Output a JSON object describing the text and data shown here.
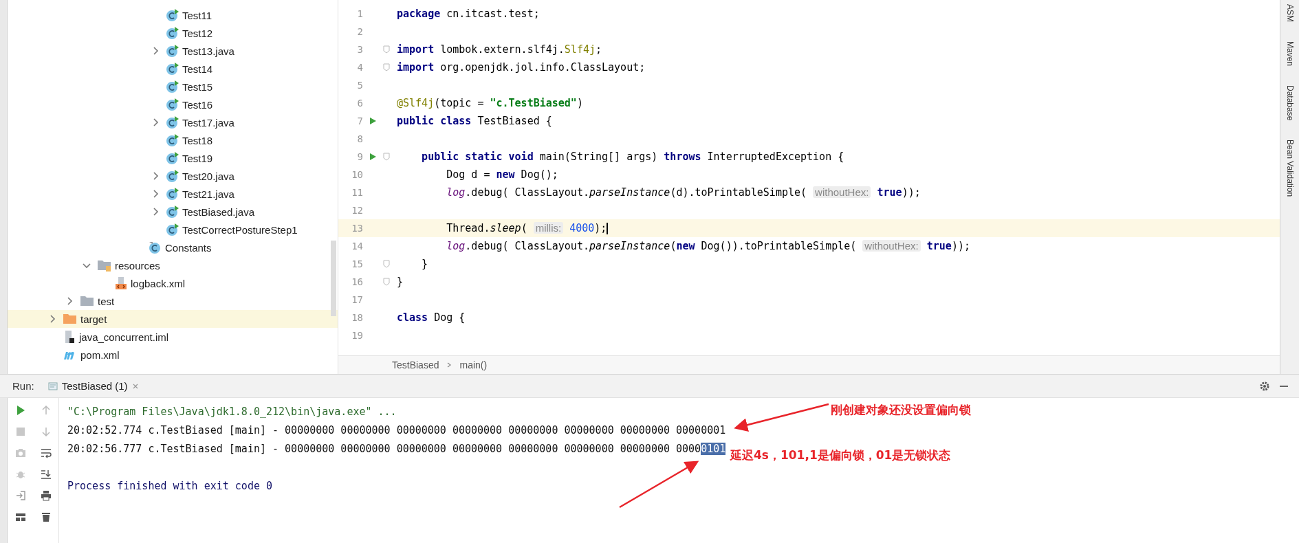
{
  "project_tree": [
    {
      "children": [
        {
          "children": [
            {
              "children": [
                {
                  "children": [
                    {
                      "children": [
                        {
                          "children": [
                            {
                              "label": "Test11",
                              "kind": "runnable-class",
                              "highlighted": false
                            },
                            {
                              "label": "Test12",
                              "kind": "runnable-class",
                              "highlighted": false
                            },
                            {
                              "label": "Test13.java",
                              "kind": "runnable-class",
                              "expanded": false,
                              "highlighted": false
                            },
                            {
                              "label": "Test14",
                              "kind": "runnable-class",
                              "highlighted": false
                            },
                            {
                              "label": "Test15",
                              "kind": "runnable-class",
                              "highlighted": false
                            },
                            {
                              "label": "Test16",
                              "kind": "runnable-class",
                              "highlighted": false
                            },
                            {
                              "label": "Test17.java",
                              "kind": "runnable-class",
                              "expanded": false,
                              "highlighted": false
                            },
                            {
                              "label": "Test18",
                              "kind": "runnable-class",
                              "highlighted": false
                            },
                            {
                              "label": "Test19",
                              "kind": "runnable-class",
                              "highlighted": false
                            },
                            {
                              "label": "Test20.java",
                              "kind": "runnable-class",
                              "expanded": false,
                              "highlighted": false
                            },
                            {
                              "label": "Test21.java",
                              "kind": "runnable-class",
                              "expanded": false,
                              "highlighted": false
                            },
                            {
                              "label": "TestBiased.java",
                              "kind": "runnable-class",
                              "expanded": false,
                              "highlighted": false
                            },
                            {
                              "label": "TestCorrectPostureStep1",
                              "kind": "runnable-class",
                              "highlighted": false
                            }
                          ]
                        },
                        {
                          "label": "Constants",
                          "kind": "class",
                          "highlighted": false
                        }
                      ]
                    }
                  ]
                }
              ]
            },
            {
              "label": "resources",
              "kind": "resources",
              "expanded": true,
              "highlighted": false,
              "children": [
                {
                  "label": "logback.xml",
                  "kind": "xml",
                  "highlighted": false
                }
              ]
            }
          ]
        },
        {
          "label": "test",
          "kind": "folder",
          "expanded": false,
          "highlighted": false
        }
      ]
    },
    {
      "label": "target",
      "kind": "excluded",
      "expanded": false,
      "highlighted": true
    },
    {
      "label": "java_concurrent.iml",
      "kind": "module",
      "highlighted": false
    },
    {
      "label": "pom.xml",
      "kind": "maven",
      "highlighted": false
    }
  ],
  "editor": {
    "lines": [
      {
        "number": "1",
        "run_marker": false,
        "fold": false,
        "current": false,
        "segments": [
          {
            "kind": "kw",
            "text": "package"
          },
          {
            "kind": "plain",
            "text": " cn.itcast.test;"
          }
        ]
      },
      {
        "number": "2",
        "run_marker": false,
        "fold": false,
        "current": false
      },
      {
        "number": "3",
        "run_marker": false,
        "fold": true,
        "current": false,
        "segments": [
          {
            "kind": "kw",
            "text": "import"
          },
          {
            "kind": "plain",
            "text": " lombok.extern.slf4j."
          },
          {
            "kind": "ann",
            "text": "Slf4j"
          },
          {
            "kind": "plain",
            "text": ";"
          }
        ]
      },
      {
        "number": "4",
        "run_marker": false,
        "fold": true,
        "current": false,
        "segments": [
          {
            "kind": "kw",
            "text": "import"
          },
          {
            "kind": "plain",
            "text": " org.openjdk.jol.info.ClassLayout;"
          }
        ]
      },
      {
        "number": "5",
        "run_marker": false,
        "fold": false,
        "current": false
      },
      {
        "number": "6",
        "run_marker": false,
        "fold": false,
        "current": false,
        "segments": [
          {
            "kind": "ann",
            "text": "@Slf4j"
          },
          {
            "kind": "plain",
            "text": "(topic = "
          },
          {
            "kind": "str",
            "text": "\"c.TestBiased\""
          },
          {
            "kind": "plain",
            "text": ")"
          }
        ]
      },
      {
        "number": "7",
        "run_marker": true,
        "fold": false,
        "current": false,
        "segments": [
          {
            "kind": "kw",
            "text": "public class"
          },
          {
            "kind": "plain",
            "text": " TestBiased {"
          }
        ]
      },
      {
        "number": "8",
        "run_marker": false,
        "fold": false,
        "current": false
      },
      {
        "number": "9",
        "run_marker": true,
        "fold": true,
        "current": false,
        "segments": [
          {
            "kind": "kw",
            "text": "    public static void"
          },
          {
            "kind": "plain",
            "text": " main(String[] args) "
          },
          {
            "kind": "kw",
            "text": "throws"
          },
          {
            "kind": "plain",
            "text": " InterruptedException {"
          }
        ]
      },
      {
        "number": "10",
        "run_marker": false,
        "fold": false,
        "current": false,
        "segments": [
          {
            "kind": "plain",
            "text": "        Dog d = "
          },
          {
            "kind": "kw",
            "text": "new"
          },
          {
            "kind": "plain",
            "text": " Dog();"
          }
        ]
      },
      {
        "number": "11",
        "run_marker": false,
        "fold": false,
        "current": false,
        "segments": [
          {
            "kind": "field",
            "text": "        log"
          },
          {
            "kind": "plain",
            "text": ".debug( ClassLayout."
          },
          {
            "kind": "italic",
            "text": "parseInstance"
          },
          {
            "kind": "plain",
            "text": "(d).toPrintableSimple( "
          },
          {
            "kind": "hint",
            "text": "withoutHex:"
          },
          {
            "kind": "kw",
            "text": " true"
          },
          {
            "kind": "plain",
            "text": "));"
          }
        ]
      },
      {
        "number": "12",
        "run_marker": false,
        "fold": false,
        "current": false
      },
      {
        "number": "13",
        "run_marker": false,
        "fold": false,
        "current": true,
        "segments": [
          {
            "kind": "plain",
            "text": "        Thread."
          },
          {
            "kind": "italic",
            "text": "sleep"
          },
          {
            "kind": "plain",
            "text": "( "
          },
          {
            "kind": "hint",
            "text": "millis:"
          },
          {
            "kind": "num",
            "text": " 4000"
          },
          {
            "kind": "plain",
            "text": ");"
          }
        ]
      },
      {
        "number": "14",
        "run_marker": false,
        "fold": false,
        "current": false,
        "segments": [
          {
            "kind": "field",
            "text": "        log"
          },
          {
            "kind": "plain",
            "text": ".debug( ClassLayout."
          },
          {
            "kind": "italic",
            "text": "parseInstance"
          },
          {
            "kind": "plain",
            "text": "("
          },
          {
            "kind": "kw",
            "text": "new"
          },
          {
            "kind": "plain",
            "text": " Dog()).toPrintableSimple( "
          },
          {
            "kind": "hint",
            "text": "withoutHex:"
          },
          {
            "kind": "kw",
            "text": " true"
          },
          {
            "kind": "plain",
            "text": "));"
          }
        ]
      },
      {
        "number": "15",
        "run_marker": false,
        "fold": true,
        "current": false,
        "segments": [
          {
            "kind": "plain",
            "text": "    }"
          }
        ]
      },
      {
        "number": "16",
        "run_marker": false,
        "fold": true,
        "current": false,
        "segments": [
          {
            "kind": "plain",
            "text": "}"
          }
        ]
      },
      {
        "number": "17",
        "run_marker": false,
        "fold": false,
        "current": false
      },
      {
        "number": "18",
        "run_marker": false,
        "fold": false,
        "current": false,
        "segments": [
          {
            "kind": "kw",
            "text": "class"
          },
          {
            "kind": "plain",
            "text": " Dog {"
          }
        ]
      },
      {
        "number": "19",
        "run_marker": false,
        "fold": false,
        "current": false
      }
    ],
    "breadcrumbs": [
      "TestBiased",
      "main()"
    ]
  },
  "side_tools": [
    "ASM",
    "Maven",
    "Database",
    "Bean Validation"
  ],
  "run_panel": {
    "label": "Run:",
    "tab": "TestBiased (1)",
    "console": [
      {
        "kind": "command",
        "parts": [
          {
            "text": "\"C:\\Program Files\\Java\\jdk1.8.0_212\\bin\\java.exe\" ...",
            "selected": false
          }
        ]
      },
      {
        "kind": "log",
        "parts": [
          {
            "text": "20:02:52.774 c.TestBiased [main] - 00000000 00000000 00000000 00000000 00000000 00000000 00000000 00000001",
            "selected": false
          }
        ]
      },
      {
        "kind": "log",
        "parts": [
          {
            "text": "20:02:56.777 c.TestBiased [main] - 00000000 00000000 00000000 00000000 00000000 00000000 00000000 0000",
            "selected": false
          },
          {
            "text": "0101",
            "selected": true
          }
        ]
      },
      {
        "kind": "blank"
      },
      {
        "kind": "exit",
        "parts": [
          {
            "text": "Process finished with exit code 0",
            "selected": false
          }
        ]
      }
    ]
  },
  "annotations": [
    "刚创建对象还没设置偏向锁",
    "延迟4s，101,1是偏向锁，01是无锁状态"
  ]
}
